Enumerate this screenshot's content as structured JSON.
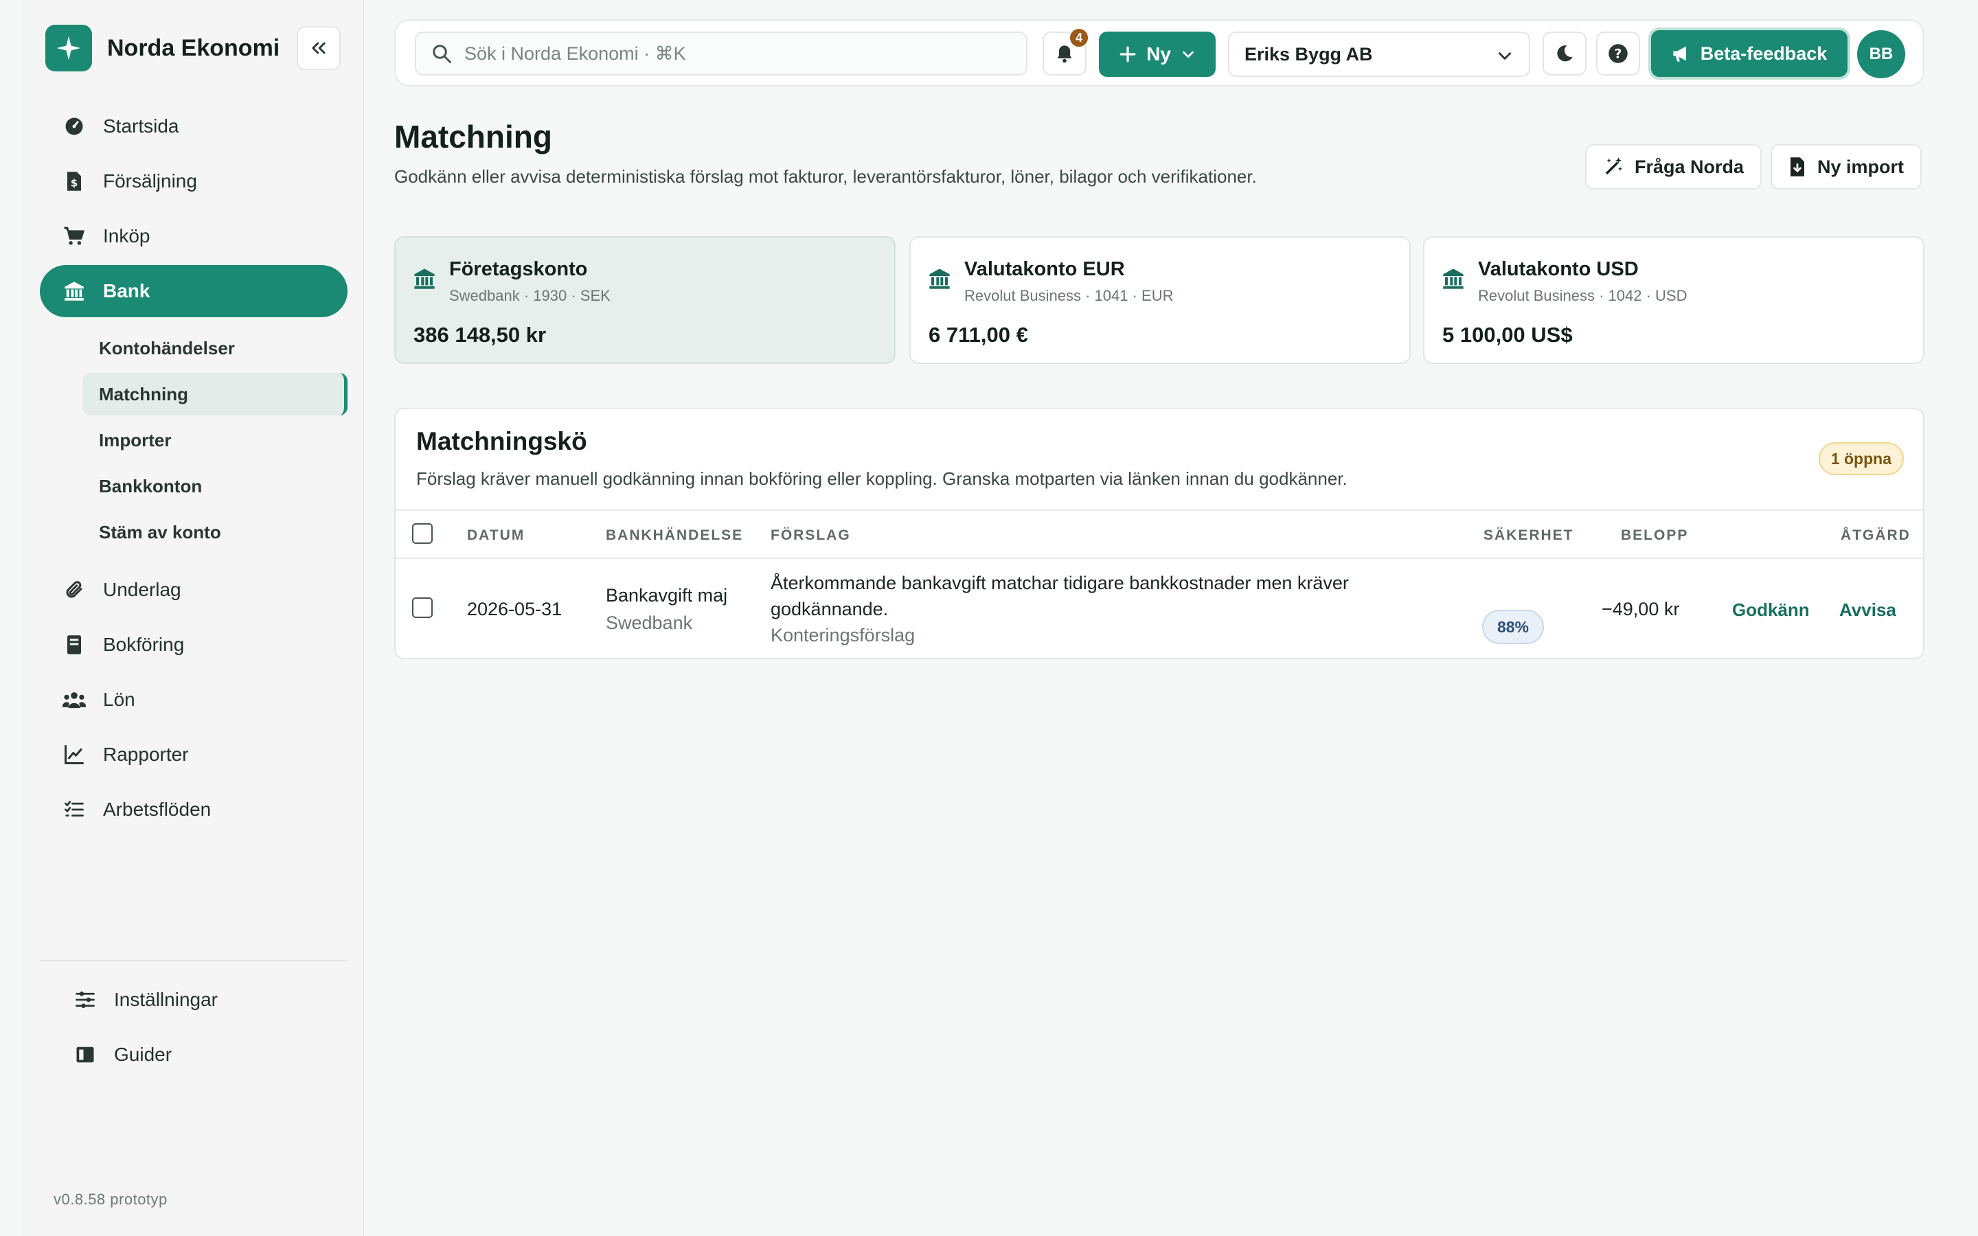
{
  "brand": {
    "name": "Norda Ekonomi"
  },
  "sidebar": {
    "items": [
      {
        "label": "Startsida",
        "icon": "dashboard-icon"
      },
      {
        "label": "Försäljning",
        "icon": "invoice-icon"
      },
      {
        "label": "Inköp",
        "icon": "cart-icon"
      },
      {
        "label": "Bank",
        "icon": "bank-icon",
        "active": true
      },
      {
        "label": "Underlag",
        "icon": "paperclip-icon"
      },
      {
        "label": "Bokföring",
        "icon": "ledger-icon"
      },
      {
        "label": "Lön",
        "icon": "people-icon"
      },
      {
        "label": "Rapporter",
        "icon": "chart-icon"
      },
      {
        "label": "Arbetsflöden",
        "icon": "checklist-icon"
      }
    ],
    "bank_sub": [
      {
        "label": "Kontohändelser"
      },
      {
        "label": "Matchning",
        "active": true
      },
      {
        "label": "Importer"
      },
      {
        "label": "Bankkonton"
      },
      {
        "label": "Stäm av konto"
      }
    ],
    "bottom": [
      {
        "label": "Inställningar",
        "icon": "sliders-icon"
      },
      {
        "label": "Guider",
        "icon": "book-icon"
      }
    ],
    "version": "v0.8.58 prototyp"
  },
  "topbar": {
    "search_placeholder": "Sök i Norda Ekonomi · ⌘K",
    "notifications_count": "4",
    "new_label": "Ny",
    "company": "Eriks Bygg AB",
    "beta_label": "Beta-feedback",
    "avatar_initials": "BB"
  },
  "page": {
    "title": "Matchning",
    "subtitle": "Godkänn eller avvisa deterministiska förslag mot fakturor, leverantörsfakturor, löner, bilagor och verifikationer.",
    "ask_label": "Fråga Norda",
    "import_label": "Ny import"
  },
  "accounts": [
    {
      "name": "Företagskonto",
      "meta": "Swedbank · 1930 · SEK",
      "balance": "386 148,50 kr",
      "active": true
    },
    {
      "name": "Valutakonto EUR",
      "meta": "Revolut Business · 1041 · EUR",
      "balance": "6 711,00 €"
    },
    {
      "name": "Valutakonto USD",
      "meta": "Revolut Business · 1042 · USD",
      "balance": "5 100,00 US$"
    }
  ],
  "queue": {
    "title": "Matchningskö",
    "subtitle": "Förslag kräver manuell godkänning innan bokföring eller koppling. Granska motparten via länken innan du godkänner.",
    "open_badge": "1 öppna",
    "columns": {
      "date": "DATUM",
      "event": "BANKHÄNDELSE",
      "proposal": "FÖRSLAG",
      "confidence": "SÄKERHET",
      "amount": "BELOPP",
      "action": "ÅTGÄRD"
    },
    "rows": [
      {
        "date": "2026-05-31",
        "event": "Bankavgift maj",
        "bank": "Swedbank",
        "proposal_line1": "Återkommande bankavgift matchar tidigare bankkostnader men kräver",
        "proposal_line2": "godkännande.",
        "proposal_type": "Konteringsförslag",
        "confidence": "88%",
        "amount": "−49,00 kr",
        "approve": "Godkänn",
        "reject": "Avvisa"
      }
    ]
  },
  "colors": {
    "accent": "#1b8a74",
    "accent_light": "#e6efec",
    "warning_badge": "#fdf2d6",
    "confidence_badge": "#e9f0f7"
  }
}
